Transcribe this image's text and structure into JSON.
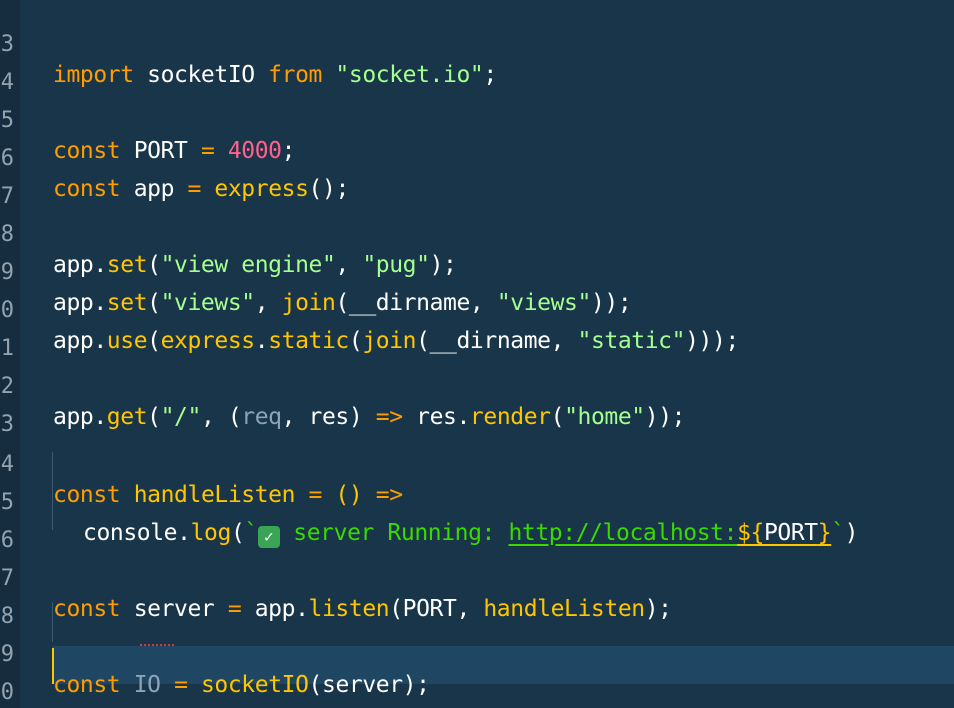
{
  "line_numbers": [
    "3",
    "4",
    "5",
    "6",
    "7",
    "8",
    "9",
    "0",
    "1",
    "2",
    "3",
    "4",
    "5",
    "6",
    "7",
    "8",
    "9",
    "0"
  ],
  "code": {
    "l3": {
      "t1": "import",
      "t2": " socketIO ",
      "t3": "from",
      "t4": " ",
      "t5": "\"socket.io\"",
      "t6": ";"
    },
    "l5": {
      "t1": "const",
      "t2": " PORT ",
      "t3": "=",
      "t4": " ",
      "t5": "4000",
      "t6": ";"
    },
    "l6": {
      "t1": "const",
      "t2": " app ",
      "t3": "=",
      "t4": " ",
      "t5": "express",
      "t6": "();"
    },
    "l8": {
      "t1": "app",
      "t2": ".",
      "t3": "set",
      "t4": "(",
      "t5": "\"view engine\"",
      "t6": ", ",
      "t7": "\"pug\"",
      "t8": ");"
    },
    "l9": {
      "t1": "app",
      "t2": ".",
      "t3": "set",
      "t4": "(",
      "t5": "\"views\"",
      "t6": ", ",
      "t7": "join",
      "t8": "(",
      "t9": "__dirname, ",
      "t10": "\"views\"",
      "t11": "));"
    },
    "l10": {
      "t1": "app",
      "t2": ".",
      "t3": "use",
      "t4": "(",
      "t5": "express",
      "t6": ".",
      "t7": "static",
      "t8": "(",
      "t9": "join",
      "t10": "(",
      "t11": "__dirname, ",
      "t12": "\"static\"",
      "t13": ")));"
    },
    "l12": {
      "t1": "app",
      "t2": ".",
      "t3": "get",
      "t4": "(",
      "t5": "\"/\"",
      "t6": ", (",
      "t7": "req",
      "t8": ", res) ",
      "t9": "=>",
      "t10": " res",
      "t11": ".",
      "t12": "render",
      "t13": "(",
      "t14": "\"home\"",
      "t15": "));"
    },
    "l14": {
      "t1": "const",
      "t2": " ",
      "t3": "handleListen",
      "t4": " ",
      "t5": "=",
      "t6": " () ",
      "t7": "=>"
    },
    "l15": {
      "t1": "console",
      "t2": ".",
      "t3": "log",
      "t4": "(",
      "t5": "`",
      "t6": "✓",
      "t7": " server Running: ",
      "t8": "http://localhost:",
      "t9": "${",
      "t10": "PORT",
      "t11": "}",
      "t12": "`",
      "t13": ")"
    },
    "l17": {
      "t1": "const",
      "t2": " server ",
      "t3": "=",
      "t4": " app",
      "t5": ".",
      "t6": "listen",
      "t7": "(PORT, ",
      "t8": "handleListen",
      "t9": ");"
    },
    "l19": {
      "t1": "const",
      "t2": " ",
      "t3": "IO",
      "t4": " ",
      "t5": "=",
      "t6": " ",
      "t7": "socketIO",
      "t8": "(server);"
    }
  },
  "colors": {
    "background": "#193549",
    "current_line": "#1f4662",
    "keyword": "#ff9d00",
    "function": "#ffc600",
    "string": "#a5ff90",
    "number": "#ff628c",
    "template": "#3ad900",
    "cursor": "#ffc600"
  }
}
